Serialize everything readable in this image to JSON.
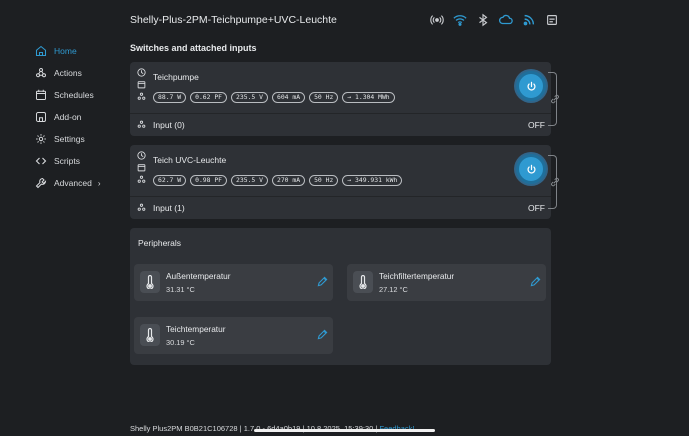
{
  "header": {
    "title": "Shelly-Plus-2PM-Teichpumpe+UVC-Leuchte",
    "status_icons": [
      "radio-icon",
      "wifi-icon",
      "bluetooth-icon",
      "cloud-icon",
      "rss-icon",
      "device-icon"
    ]
  },
  "sidebar": {
    "items": [
      {
        "label": "Home",
        "icon": "home-icon"
      },
      {
        "label": "Actions",
        "icon": "actions-icon"
      },
      {
        "label": "Schedules",
        "icon": "calendar-icon"
      },
      {
        "label": "Add-on",
        "icon": "addon-icon"
      },
      {
        "label": "Settings",
        "icon": "gear-icon"
      },
      {
        "label": "Scripts",
        "icon": "code-icon"
      },
      {
        "label": "Advanced",
        "icon": "wrench-icon",
        "chevron": "›"
      }
    ]
  },
  "main": {
    "section_title": "Switches and attached inputs",
    "switches": [
      {
        "name": "Teichpumpe",
        "chips": [
          "88.7 W",
          "0.62 PF",
          "235.5 V",
          "604 mA",
          "50 Hz",
          "→ 1.304 MWh"
        ],
        "input_label": "Input (0)",
        "input_state": "OFF"
      },
      {
        "name": "Teich UVC-Leuchte",
        "chips": [
          "62.7 W",
          "0.98 PF",
          "235.5 V",
          "270 mA",
          "50 Hz",
          "→ 349.931 kWh"
        ],
        "input_label": "Input (1)",
        "input_state": "OFF"
      }
    ],
    "peripherals": {
      "title": "Peripherals",
      "sensors": [
        {
          "name": "Außentemperatur",
          "value": "31.31 °C"
        },
        {
          "name": "Teichfiltertemperatur",
          "value": "27.12 °C"
        },
        {
          "name": "Teichtemperatur",
          "value": "30.19 °C"
        }
      ]
    }
  },
  "footer": {
    "device": "Shelly Plus2PM B0B21C106728",
    "separator": "|",
    "version": "1.7.0 - 6d4a0b19",
    "date": "10.8.2025, 15:39:30",
    "link": "Feedback!"
  },
  "colors": {
    "accent": "#2f9ad1",
    "background": "#1d1f22",
    "card": "#2e3136"
  }
}
